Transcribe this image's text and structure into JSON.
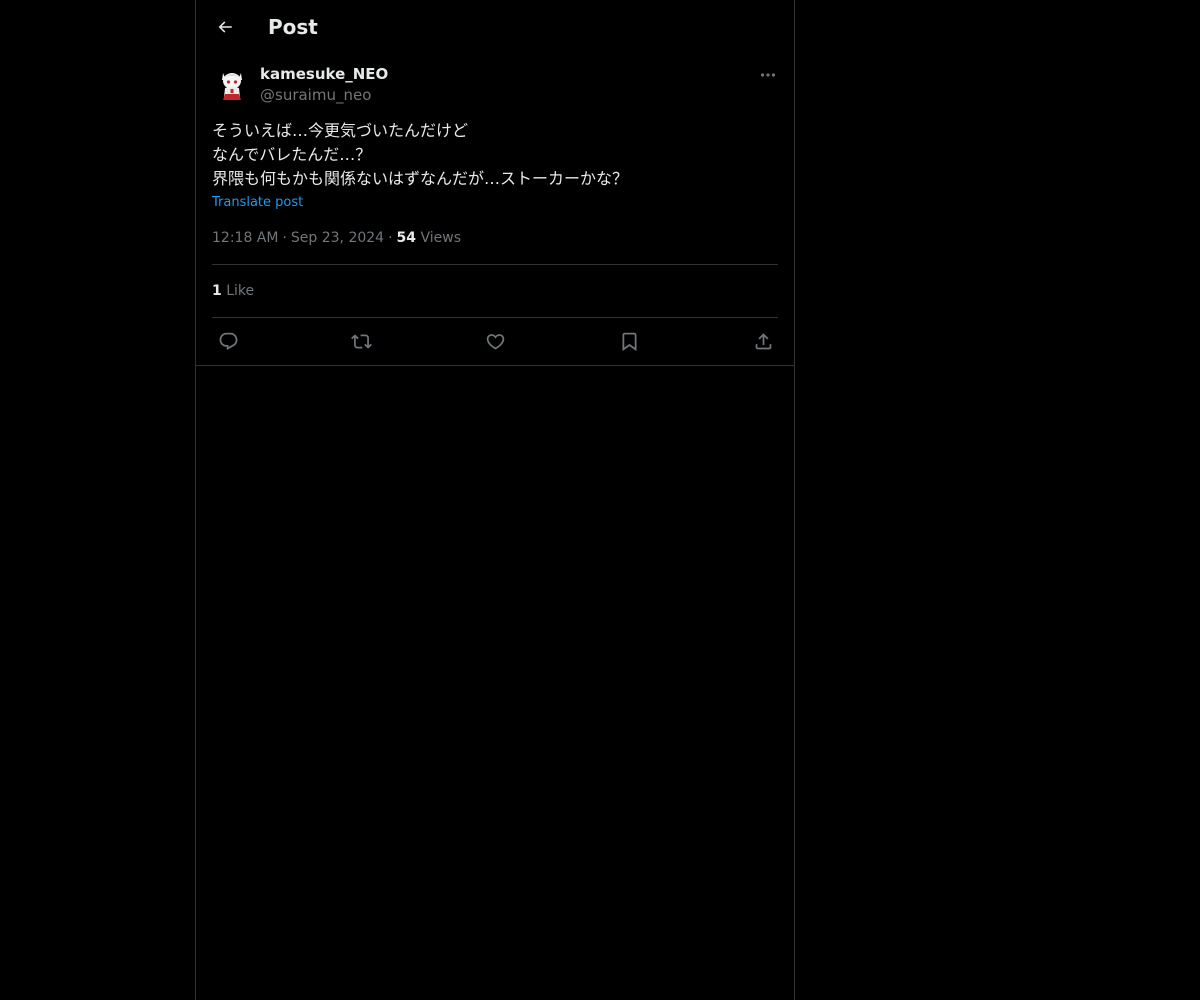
{
  "header": {
    "title": "Post",
    "back_icon": "arrow-left-icon"
  },
  "author": {
    "display_name": "kamesuke_NEO",
    "handle": "@suraimu_neo",
    "avatar_icon": "avatar-icon"
  },
  "post": {
    "lines": [
      "そういえば…今更気づいたんだけど",
      "なんでバレたんだ…？",
      "界隈も何もかも関係ないはずなんだが…ストーカーかな？"
    ],
    "translate_label": "Translate post",
    "time": "12:18 AM",
    "date": "Sep 23, 2024",
    "separator": "·",
    "views_count": "54",
    "views_label": "Views"
  },
  "engagement": {
    "likes_count": "1",
    "likes_label": "Like"
  },
  "actions": {
    "icons": [
      "reply-icon",
      "repost-icon",
      "like-icon",
      "bookmark-icon",
      "share-icon"
    ]
  },
  "colors": {
    "background": "#000000",
    "text_primary": "#e7e9ea",
    "text_secondary": "#71767b",
    "accent": "#1d9bf0",
    "border": "#2f3336"
  }
}
